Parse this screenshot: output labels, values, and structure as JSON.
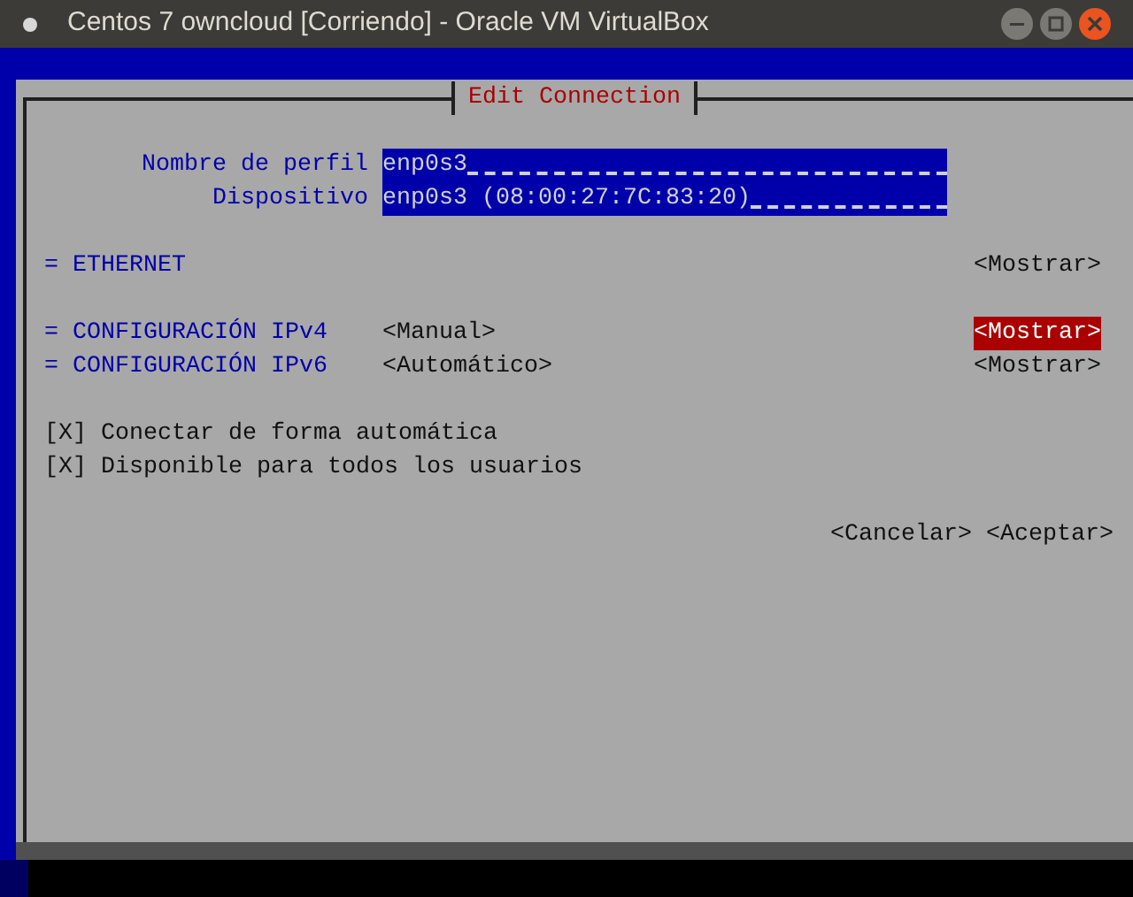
{
  "window": {
    "title": "Centos 7 owncloud [Corriendo] - Oracle VM VirtualBox"
  },
  "dialog": {
    "title": "Edit Connection",
    "fields": [
      {
        "label": "Nombre de perfil",
        "value": "enp0s3"
      },
      {
        "label": "Dispositivo",
        "value": "enp0s3 (08:00:27:7C:83:20)"
      }
    ],
    "sections": [
      {
        "label": "= ETHERNET",
        "button": "<Mostrar>",
        "selected": false
      },
      {
        "label": "= CONFIGURACIÓN IPv4",
        "mode": "<Manual>",
        "button": "<Mostrar>",
        "selected": true
      },
      {
        "label": "= CONFIGURACIÓN IPv6",
        "mode": "<Automático>",
        "button": "<Mostrar>",
        "selected": false
      }
    ],
    "checkboxes": [
      {
        "box": "[X]",
        "label": "Conectar de forma automática",
        "checked": true
      },
      {
        "box": "[X]",
        "label": "Disponible para todos los usuarios",
        "checked": true
      }
    ],
    "buttons": [
      "<Cancelar>",
      "<Aceptar>"
    ]
  }
}
